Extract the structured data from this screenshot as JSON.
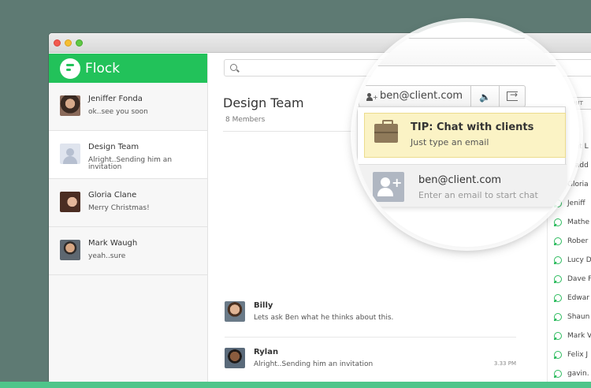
{
  "app": {
    "name": "Flock"
  },
  "search": {
    "placeholder": ""
  },
  "chats": [
    {
      "name": "Jeniffer Fonda",
      "preview": "ok..see you soon"
    },
    {
      "name": "Design Team",
      "preview": "Alright..Sending him an invitation"
    },
    {
      "name": "Gloria Clane",
      "preview": "Merry Christmas!"
    },
    {
      "name": "Mark Waugh",
      "preview": "yeah..sure"
    }
  ],
  "conversation": {
    "title": "Design Team",
    "members": "8 Members",
    "messages": [
      {
        "author": "Billy",
        "text": "Lets ask Ben what he thinks about this.",
        "time": ""
      },
      {
        "author": "Rylan",
        "text": "Alright..Sending him an invitation",
        "time": "3.33 PM"
      }
    ]
  },
  "contacts": {
    "add_button": "DD CONT",
    "heading": "ENT CO",
    "items": [
      "Bret L",
      "Bradd",
      "Gloria",
      "Jeniff",
      "Mathe",
      "Rober",
      "Lucy D",
      "Dave F",
      "Edwar",
      "Shaun",
      "Mark V",
      "Felix J",
      "gavin."
    ]
  },
  "magnifier": {
    "email_chip": "ben@client.com",
    "tip_title": "TIP: Chat with clients",
    "tip_sub": "Just type an email",
    "suggest_email": "ben@client.com",
    "suggest_hint": "Enter an email to start chat"
  },
  "colors": {
    "brand": "#22c25a",
    "background": "#5e7a73",
    "tip": "#fbf3c5"
  }
}
